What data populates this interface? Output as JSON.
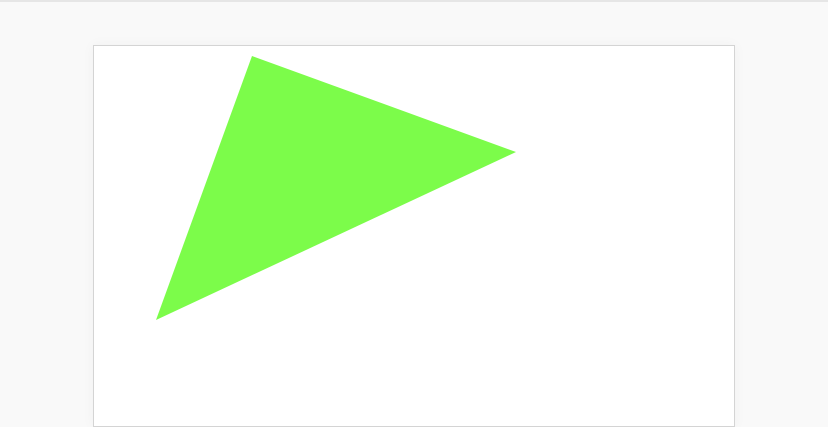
{
  "page": {
    "background_color": "#f9f9f9",
    "canvas_background_color": "#ffffff",
    "canvas_border_color": "#d4d4d4"
  },
  "shapes": [
    {
      "kind": "triangle",
      "fill_color": "#7cfc4a"
    }
  ]
}
